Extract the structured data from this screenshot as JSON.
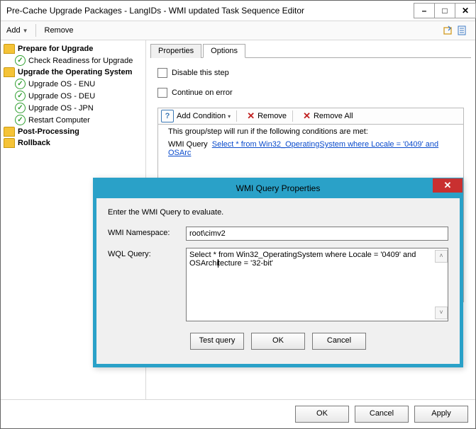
{
  "title": "Pre-Cache Upgrade Packages - LangIDs - WMI updated Task Sequence Editor",
  "toolbar": {
    "add": "Add",
    "remove": "Remove"
  },
  "tree": {
    "items": [
      {
        "label": "Prepare for Upgrade",
        "type": "folder",
        "bold": true
      },
      {
        "label": "Check Readiness for Upgrade",
        "type": "check",
        "bold": false,
        "child": true
      },
      {
        "label": "Upgrade the Operating System",
        "type": "folder",
        "bold": true
      },
      {
        "label": "Upgrade OS - ENU",
        "type": "check",
        "bold": false,
        "child": true
      },
      {
        "label": "Upgrade OS - DEU",
        "type": "check",
        "bold": false,
        "child": true
      },
      {
        "label": "Upgrade OS - JPN",
        "type": "check",
        "bold": false,
        "child": true
      },
      {
        "label": "Restart Computer",
        "type": "check",
        "bold": false,
        "child": true
      },
      {
        "label": "Post-Processing",
        "type": "folder",
        "bold": true
      },
      {
        "label": "Rollback",
        "type": "folder",
        "bold": true
      }
    ]
  },
  "tabs": {
    "properties": "Properties",
    "options": "Options"
  },
  "options": {
    "disable": "Disable this step",
    "continue": "Continue on error",
    "addCondition": "Add Condition",
    "remove": "Remove",
    "removeAll": "Remove All",
    "condHeader": "This group/step will run if the following conditions are met:",
    "wmiLabel": "WMI Query",
    "wmiLink": "Select * from Win32_OperatingSystem where Locale = '0409' and OSArc"
  },
  "buttons": {
    "ok": "OK",
    "cancel": "Cancel",
    "apply": "Apply"
  },
  "dialog": {
    "title": "WMI Query Properties",
    "intro": "Enter the WMI Query to evaluate.",
    "nsLabel": "WMI Namespace:",
    "nsValue": "root\\cimv2",
    "queryLabel": "WQL Query:",
    "queryValue1": "Select * from Win32_OperatingSystem where Locale = '0409' and OSArchi",
    "queryValue2": "tecture = '32-bit'",
    "test": "Test query",
    "ok": "OK",
    "cancel": "Cancel"
  }
}
